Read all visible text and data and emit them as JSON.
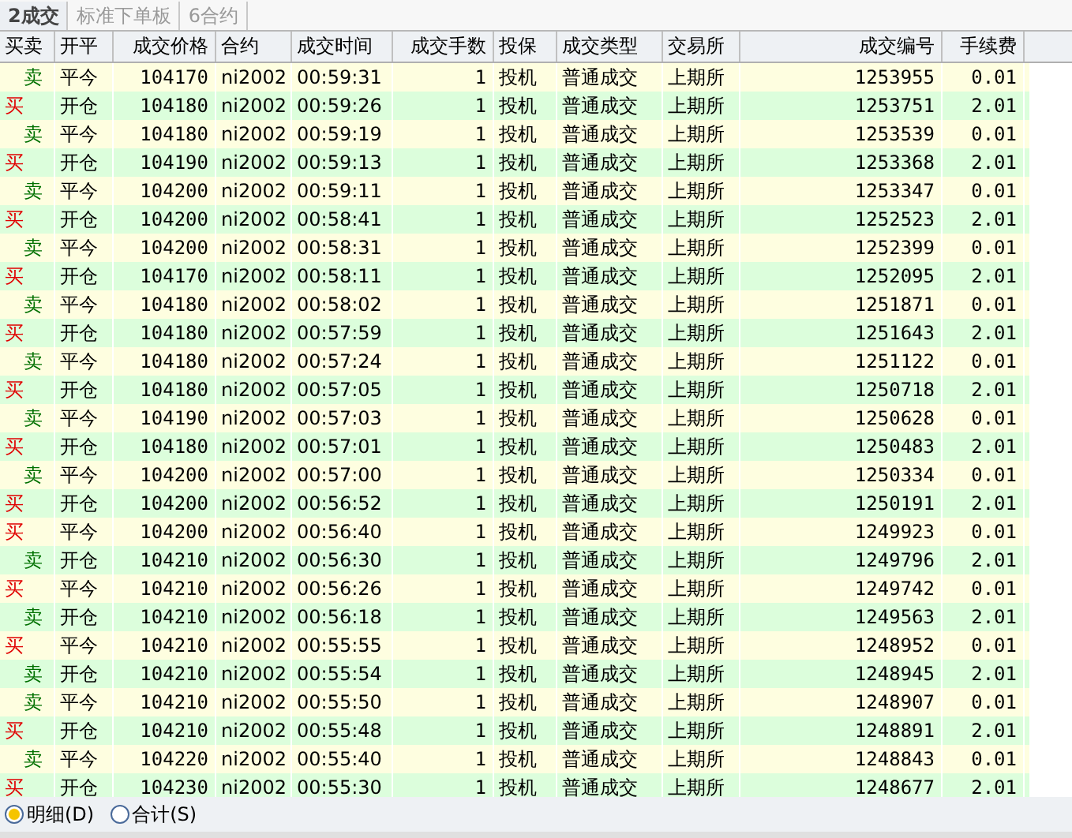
{
  "tabs": [
    {
      "label": "2成交",
      "selected": true
    },
    {
      "label": "标准下单板",
      "selected": false
    },
    {
      "label": "6合约",
      "selected": false
    }
  ],
  "table": {
    "columns": [
      "买卖",
      "开平",
      "成交价格",
      "合约",
      "成交时间",
      "成交手数",
      "投保",
      "成交类型",
      "交易所",
      "成交编号",
      "手续费"
    ],
    "rows": [
      {
        "kind": "sell",
        "cells": [
          "卖",
          "平今",
          "104170",
          "ni2002",
          "00:59:31",
          "1",
          "投机",
          "普通成交",
          "上期所",
          "1253955",
          "0.01"
        ]
      },
      {
        "kind": "buy",
        "cells": [
          "买",
          "开仓",
          "104180",
          "ni2002",
          "00:59:26",
          "1",
          "投机",
          "普通成交",
          "上期所",
          "1253751",
          "2.01"
        ]
      },
      {
        "kind": "sell",
        "cells": [
          "卖",
          "平今",
          "104180",
          "ni2002",
          "00:59:19",
          "1",
          "投机",
          "普通成交",
          "上期所",
          "1253539",
          "0.01"
        ]
      },
      {
        "kind": "buy",
        "cells": [
          "买",
          "开仓",
          "104190",
          "ni2002",
          "00:59:13",
          "1",
          "投机",
          "普通成交",
          "上期所",
          "1253368",
          "2.01"
        ]
      },
      {
        "kind": "sell",
        "cells": [
          "卖",
          "平今",
          "104200",
          "ni2002",
          "00:59:11",
          "1",
          "投机",
          "普通成交",
          "上期所",
          "1253347",
          "0.01"
        ]
      },
      {
        "kind": "buy",
        "cells": [
          "买",
          "开仓",
          "104200",
          "ni2002",
          "00:58:41",
          "1",
          "投机",
          "普通成交",
          "上期所",
          "1252523",
          "2.01"
        ]
      },
      {
        "kind": "sell",
        "cells": [
          "卖",
          "平今",
          "104200",
          "ni2002",
          "00:58:31",
          "1",
          "投机",
          "普通成交",
          "上期所",
          "1252399",
          "0.01"
        ]
      },
      {
        "kind": "buy",
        "cells": [
          "买",
          "开仓",
          "104170",
          "ni2002",
          "00:58:11",
          "1",
          "投机",
          "普通成交",
          "上期所",
          "1252095",
          "2.01"
        ]
      },
      {
        "kind": "sell",
        "cells": [
          "卖",
          "平今",
          "104180",
          "ni2002",
          "00:58:02",
          "1",
          "投机",
          "普通成交",
          "上期所",
          "1251871",
          "0.01"
        ]
      },
      {
        "kind": "buy",
        "cells": [
          "买",
          "开仓",
          "104180",
          "ni2002",
          "00:57:59",
          "1",
          "投机",
          "普通成交",
          "上期所",
          "1251643",
          "2.01"
        ]
      },
      {
        "kind": "sell",
        "cells": [
          "卖",
          "平今",
          "104180",
          "ni2002",
          "00:57:24",
          "1",
          "投机",
          "普通成交",
          "上期所",
          "1251122",
          "0.01"
        ]
      },
      {
        "kind": "buy",
        "cells": [
          "买",
          "开仓",
          "104180",
          "ni2002",
          "00:57:05",
          "1",
          "投机",
          "普通成交",
          "上期所",
          "1250718",
          "2.01"
        ]
      },
      {
        "kind": "sell",
        "cells": [
          "卖",
          "平今",
          "104190",
          "ni2002",
          "00:57:03",
          "1",
          "投机",
          "普通成交",
          "上期所",
          "1250628",
          "0.01"
        ]
      },
      {
        "kind": "buy",
        "cells": [
          "买",
          "开仓",
          "104180",
          "ni2002",
          "00:57:01",
          "1",
          "投机",
          "普通成交",
          "上期所",
          "1250483",
          "2.01"
        ]
      },
      {
        "kind": "sell",
        "cells": [
          "卖",
          "平今",
          "104200",
          "ni2002",
          "00:57:00",
          "1",
          "投机",
          "普通成交",
          "上期所",
          "1250334",
          "0.01"
        ]
      },
      {
        "kind": "buy",
        "cells": [
          "买",
          "开仓",
          "104200",
          "ni2002",
          "00:56:52",
          "1",
          "投机",
          "普通成交",
          "上期所",
          "1250191",
          "2.01"
        ]
      },
      {
        "kind": "buy",
        "cells": [
          "买",
          "平今",
          "104200",
          "ni2002",
          "00:56:40",
          "1",
          "投机",
          "普通成交",
          "上期所",
          "1249923",
          "0.01"
        ]
      },
      {
        "kind": "sell",
        "cells": [
          "卖",
          "开仓",
          "104210",
          "ni2002",
          "00:56:30",
          "1",
          "投机",
          "普通成交",
          "上期所",
          "1249796",
          "2.01"
        ]
      },
      {
        "kind": "buy",
        "cells": [
          "买",
          "平今",
          "104210",
          "ni2002",
          "00:56:26",
          "1",
          "投机",
          "普通成交",
          "上期所",
          "1249742",
          "0.01"
        ]
      },
      {
        "kind": "sell",
        "cells": [
          "卖",
          "开仓",
          "104210",
          "ni2002",
          "00:56:18",
          "1",
          "投机",
          "普通成交",
          "上期所",
          "1249563",
          "2.01"
        ]
      },
      {
        "kind": "buy",
        "cells": [
          "买",
          "平今",
          "104210",
          "ni2002",
          "00:55:55",
          "1",
          "投机",
          "普通成交",
          "上期所",
          "1248952",
          "0.01"
        ]
      },
      {
        "kind": "sell",
        "cells": [
          "卖",
          "开仓",
          "104210",
          "ni2002",
          "00:55:54",
          "1",
          "投机",
          "普通成交",
          "上期所",
          "1248945",
          "2.01"
        ]
      },
      {
        "kind": "sell",
        "cells": [
          "卖",
          "平今",
          "104210",
          "ni2002",
          "00:55:50",
          "1",
          "投机",
          "普通成交",
          "上期所",
          "1248907",
          "0.01"
        ]
      },
      {
        "kind": "buy",
        "cells": [
          "买",
          "开仓",
          "104210",
          "ni2002",
          "00:55:48",
          "1",
          "投机",
          "普通成交",
          "上期所",
          "1248891",
          "2.01"
        ]
      },
      {
        "kind": "sell",
        "cells": [
          "卖",
          "平今",
          "104220",
          "ni2002",
          "00:55:40",
          "1",
          "投机",
          "普通成交",
          "上期所",
          "1248843",
          "0.01"
        ]
      },
      {
        "kind": "buy",
        "cells": [
          "买",
          "开仓",
          "104230",
          "ni2002",
          "00:55:30",
          "1",
          "投机",
          "普通成交",
          "上期所",
          "1248677",
          "2.01"
        ]
      }
    ]
  },
  "view_options": [
    {
      "label": "明细(D)",
      "selected": true
    },
    {
      "label": "合计(S)",
      "selected": false
    }
  ]
}
